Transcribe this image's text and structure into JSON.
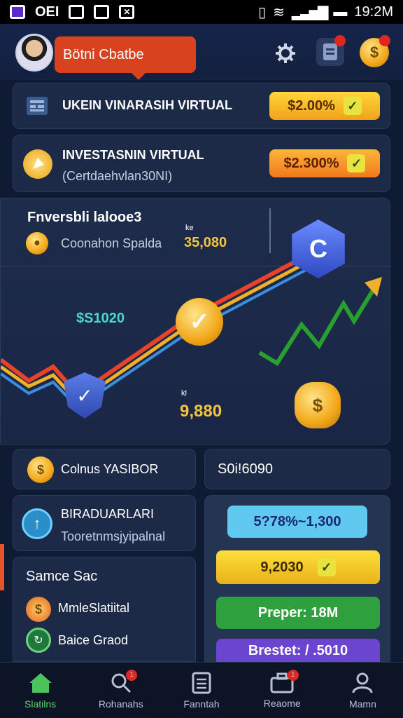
{
  "status_bar": {
    "left_text": "OEI",
    "time": "19:2M"
  },
  "header": {
    "user_name": "Bötni Cbatbe"
  },
  "cards": {
    "card1": {
      "title": "UKEIN VINARASIH VIRTUAL",
      "pill": "$2.00%"
    },
    "card2": {
      "title": "INVESTASNIN VIRTUAL",
      "subtitle": "(Certdaehvlan30NI)",
      "pill": "$2.300%"
    }
  },
  "chart": {
    "title": "Fnversbli lalooe3",
    "row_label": "Coonahon Spalda",
    "small_label_1": "ke",
    "value_1": "35,080",
    "value_mid": "$S1020",
    "small_label_2": "kl",
    "value_2": "9,880"
  },
  "coins_row": {
    "label": "Colnus YASIBOR",
    "value": "S0i!6090"
  },
  "left_panel": {
    "title": "BIRADUARLARI",
    "subtitle": "Tooretnmsjyipalnal",
    "section": "Samce Sac",
    "items": [
      {
        "label": "MmleSlatiital"
      },
      {
        "label": "Baice Graod"
      }
    ]
  },
  "right_panel": {
    "pills": [
      {
        "text": "5?78%~1,300",
        "color": "#4fc0e8"
      },
      {
        "text": "9,2030",
        "color": "#e8c51e"
      },
      {
        "text": "Preper: 18M",
        "color": "#2c9a3a"
      },
      {
        "text": "Brestet: / .5010",
        "color": "#6b3fc9"
      }
    ]
  },
  "bottom_nav": [
    {
      "label": "Slatilns",
      "icon": "home-icon",
      "active": true
    },
    {
      "label": "Rohanahs",
      "icon": "search-icon",
      "badge": "1"
    },
    {
      "label": "Fanntah",
      "icon": "document-icon"
    },
    {
      "label": "Reaome",
      "icon": "briefcase-icon",
      "badge": "1"
    },
    {
      "label": "Mamn",
      "icon": "user-icon"
    }
  ]
}
